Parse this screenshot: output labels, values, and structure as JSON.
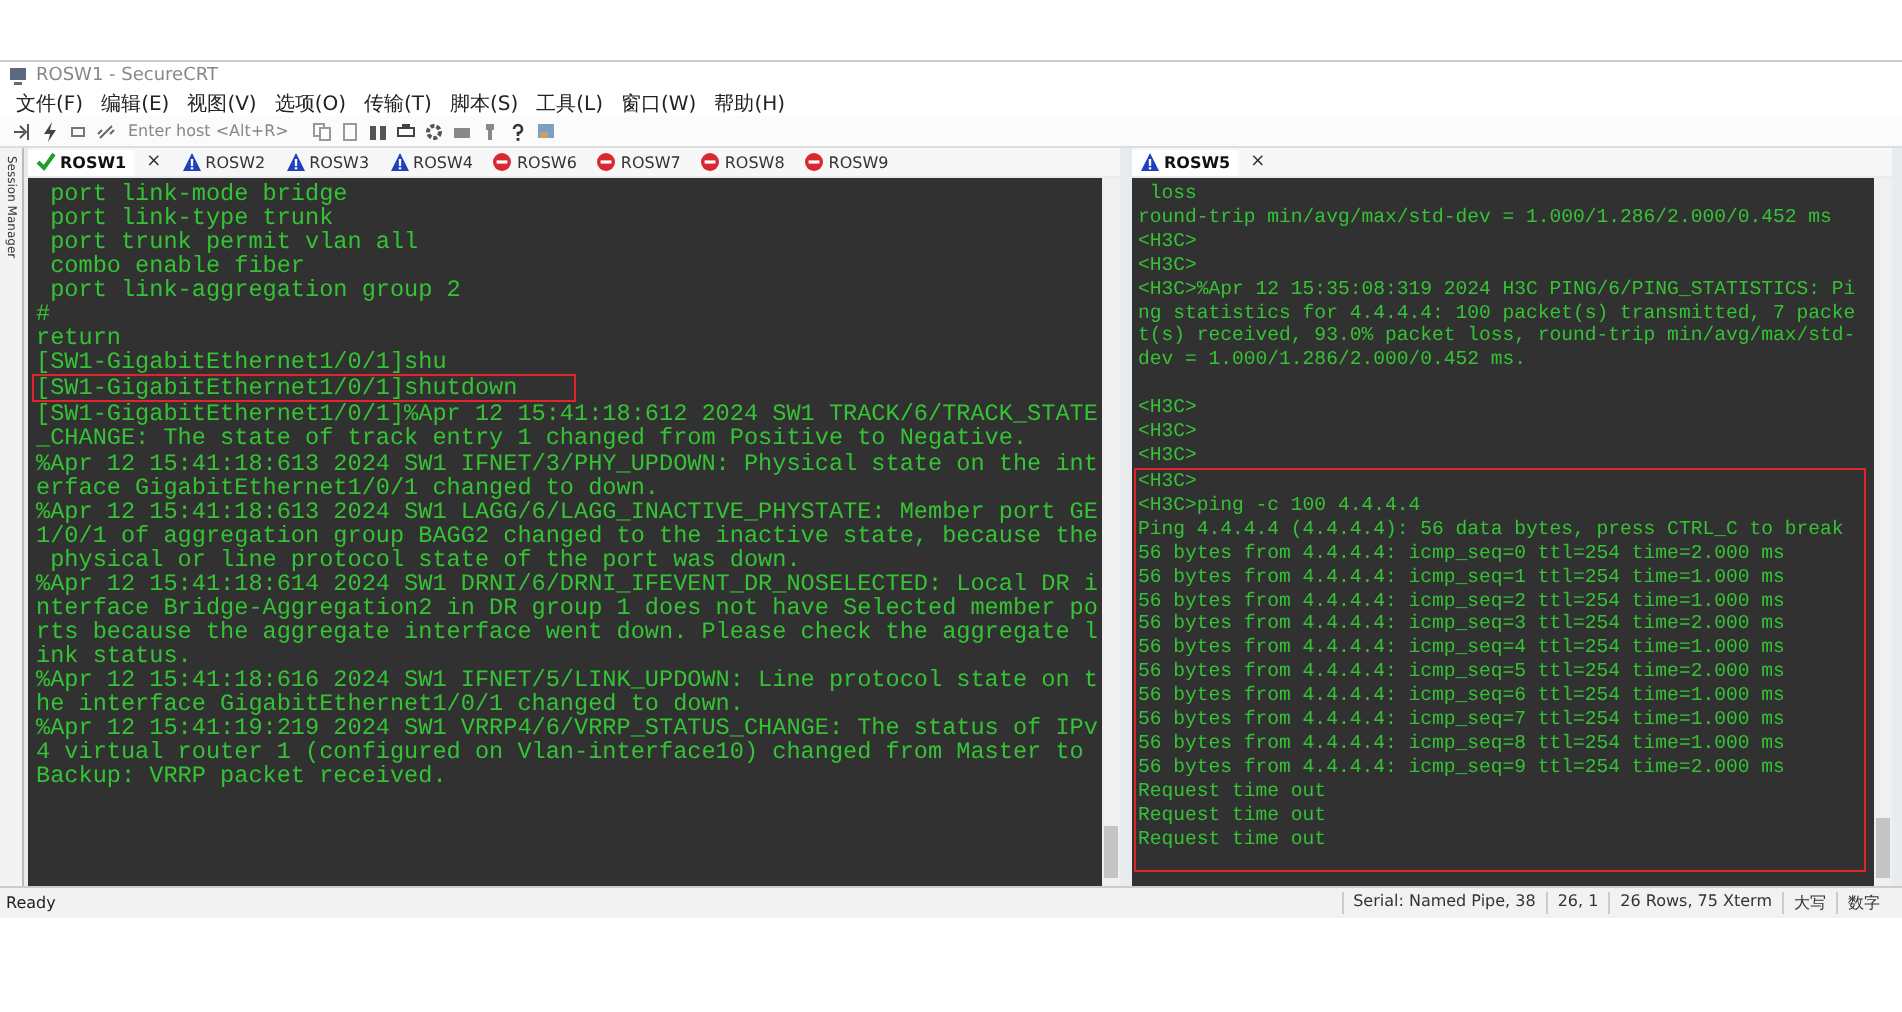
{
  "window": {
    "title": "ROSW1 - SecureCRT"
  },
  "menu": [
    "文件(F)",
    "编辑(E)",
    "视图(V)",
    "选项(O)",
    "传输(T)",
    "脚本(S)",
    "工具(L)",
    "窗口(W)",
    "帮助(H)"
  ],
  "toolbar": {
    "host_placeholder": "Enter host <Alt+R>"
  },
  "side_panel": {
    "label": "Session Manager"
  },
  "left_pane": {
    "tabs": [
      {
        "label": "ROSW1",
        "kind": "ok",
        "selected": true,
        "close": "×"
      },
      {
        "label": "ROSW2",
        "kind": "warning",
        "selected": false
      },
      {
        "label": "ROSW3",
        "kind": "warning",
        "selected": false
      },
      {
        "label": "ROSW4",
        "kind": "warning",
        "selected": false
      },
      {
        "label": "ROSW6",
        "kind": "error",
        "selected": false
      },
      {
        "label": "ROSW7",
        "kind": "error",
        "selected": false
      },
      {
        "label": "ROSW8",
        "kind": "error",
        "selected": false
      },
      {
        "label": "ROSW9",
        "kind": "error",
        "selected": false
      }
    ],
    "lines_before": [
      " port link-mode bridge",
      " port link-type trunk",
      " port trunk permit vlan all",
      " combo enable fiber",
      " port link-aggregation group 2",
      "#",
      "return",
      "[SW1-GigabitEthernet1/0/1]shu"
    ],
    "highlighted_lines": [
      "[SW1-GigabitEthernet1/0/1]shutdown"
    ],
    "lines_after": [
      "[SW1-GigabitEthernet1/0/1]%Apr 12 15:41:18:612 2024 SW1 TRACK/6/TRACK_STATE",
      "_CHANGE: The state of track entry 1 changed from Positive to Negative.",
      "%Apr 12 15:41:18:613 2024 SW1 IFNET/3/PHY_UPDOWN: Physical state on the int",
      "erface GigabitEthernet1/0/1 changed to down.",
      "%Apr 12 15:41:18:613 2024 SW1 LAGG/6/LAGG_INACTIVE_PHYSTATE: Member port GE",
      "1/0/1 of aggregation group BAGG2 changed to the inactive state, because the",
      " physical or line protocol state of the port was down.",
      "%Apr 12 15:41:18:614 2024 SW1 DRNI/6/DRNI_IFEVENT_DR_NOSELECTED: Local DR i",
      "nterface Bridge-Aggregation2 in DR group 1 does not have Selected member po",
      "rts because the aggregate interface went down. Please check the aggregate l",
      "ink status.",
      "%Apr 12 15:41:18:616 2024 SW1 IFNET/5/LINK_UPDOWN: Line protocol state on t",
      "he interface GigabitEthernet1/0/1 changed to down.",
      "%Apr 12 15:41:19:219 2024 SW1 VRRP4/6/VRRP_STATUS_CHANGE: The status of IPv",
      "4 virtual router 1 (configured on Vlan-interface10) changed from Master to",
      "Backup: VRRP packet received."
    ]
  },
  "right_pane": {
    "tabs": [
      {
        "label": "ROSW5",
        "kind": "warning",
        "selected": true,
        "close": "×"
      }
    ],
    "lines_before": [
      " loss",
      "round-trip min/avg/max/std-dev = 1.000/1.286/2.000/0.452 ms",
      "<H3C>",
      "<H3C>",
      "<H3C>%Apr 12 15:35:08:319 2024 H3C PING/6/PING_STATISTICS: Pi",
      "ng statistics for 4.4.4.4: 100 packet(s) transmitted, 7 packe",
      "t(s) received, 93.0% packet loss, round-trip min/avg/max/std-",
      "dev = 1.000/1.286/2.000/0.452 ms."
    ],
    "lines_after_blank": [
      "<H3C>",
      "<H3C>",
      "<H3C>"
    ],
    "highlighted_lines": [
      "<H3C>",
      "<H3C>ping -c 100 4.4.4.4",
      "Ping 4.4.4.4 (4.4.4.4): 56 data bytes, press CTRL_C to break",
      "56 bytes from 4.4.4.4: icmp_seq=0 ttl=254 time=2.000 ms",
      "56 bytes from 4.4.4.4: icmp_seq=1 ttl=254 time=1.000 ms",
      "56 bytes from 4.4.4.4: icmp_seq=2 ttl=254 time=1.000 ms",
      "56 bytes from 4.4.4.4: icmp_seq=3 ttl=254 time=2.000 ms",
      "56 bytes from 4.4.4.4: icmp_seq=4 ttl=254 time=1.000 ms",
      "56 bytes from 4.4.4.4: icmp_seq=5 ttl=254 time=2.000 ms",
      "56 bytes from 4.4.4.4: icmp_seq=6 ttl=254 time=1.000 ms",
      "56 bytes from 4.4.4.4: icmp_seq=7 ttl=254 time=1.000 ms",
      "56 bytes from 4.4.4.4: icmp_seq=8 ttl=254 time=1.000 ms",
      "56 bytes from 4.4.4.4: icmp_seq=9 ttl=254 time=2.000 ms",
      "Request time out",
      "Request time out",
      "Request time out"
    ]
  },
  "status_bar": {
    "message": "Ready",
    "cells": [
      "Serial: Named Pipe, 38",
      "26,  1",
      "26 Rows, 75 Xterm",
      "大写",
      "数字"
    ]
  }
}
